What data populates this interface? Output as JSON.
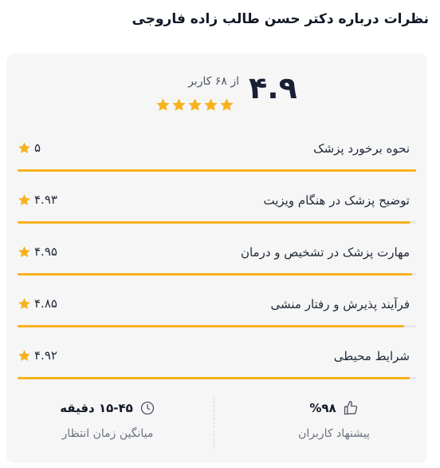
{
  "header": {
    "title": "نظرات درباره دکتر حسن طالب زاده فاروجی"
  },
  "summary": {
    "score": "۴.۹",
    "reviewers_text": "از ۶۸ کاربر",
    "stars": 5,
    "star_color": "#f7b21c"
  },
  "criteria": [
    {
      "label": "نحوه برخورد پزشک",
      "score": "۵",
      "fraction": 1.0
    },
    {
      "label": "توضیح پزشک در هنگام ویزیت",
      "score": "۴.۹۳",
      "fraction": 0.986
    },
    {
      "label": "مهارت پزشک در تشخیص و درمان",
      "score": "۴.۹۵",
      "fraction": 0.99
    },
    {
      "label": "فرآیند پذیرش و رفتار منشی",
      "score": "۴.۸۵",
      "fraction": 0.97
    },
    {
      "label": "شرایط محیطی",
      "score": "۴.۹۲",
      "fraction": 0.984
    }
  ],
  "stats": {
    "recommend": {
      "value": "%۹۸",
      "label": "پیشنهاد کاربران",
      "icon": "thumbs-up-icon"
    },
    "wait": {
      "value": "۱۵-۴۵ دقیقه",
      "label": "میانگین زمان انتظار",
      "icon": "clock-icon"
    }
  },
  "colors": {
    "accent": "#f7b21c",
    "track": "#e5e7eb",
    "card_bg": "#f6f6f7"
  }
}
